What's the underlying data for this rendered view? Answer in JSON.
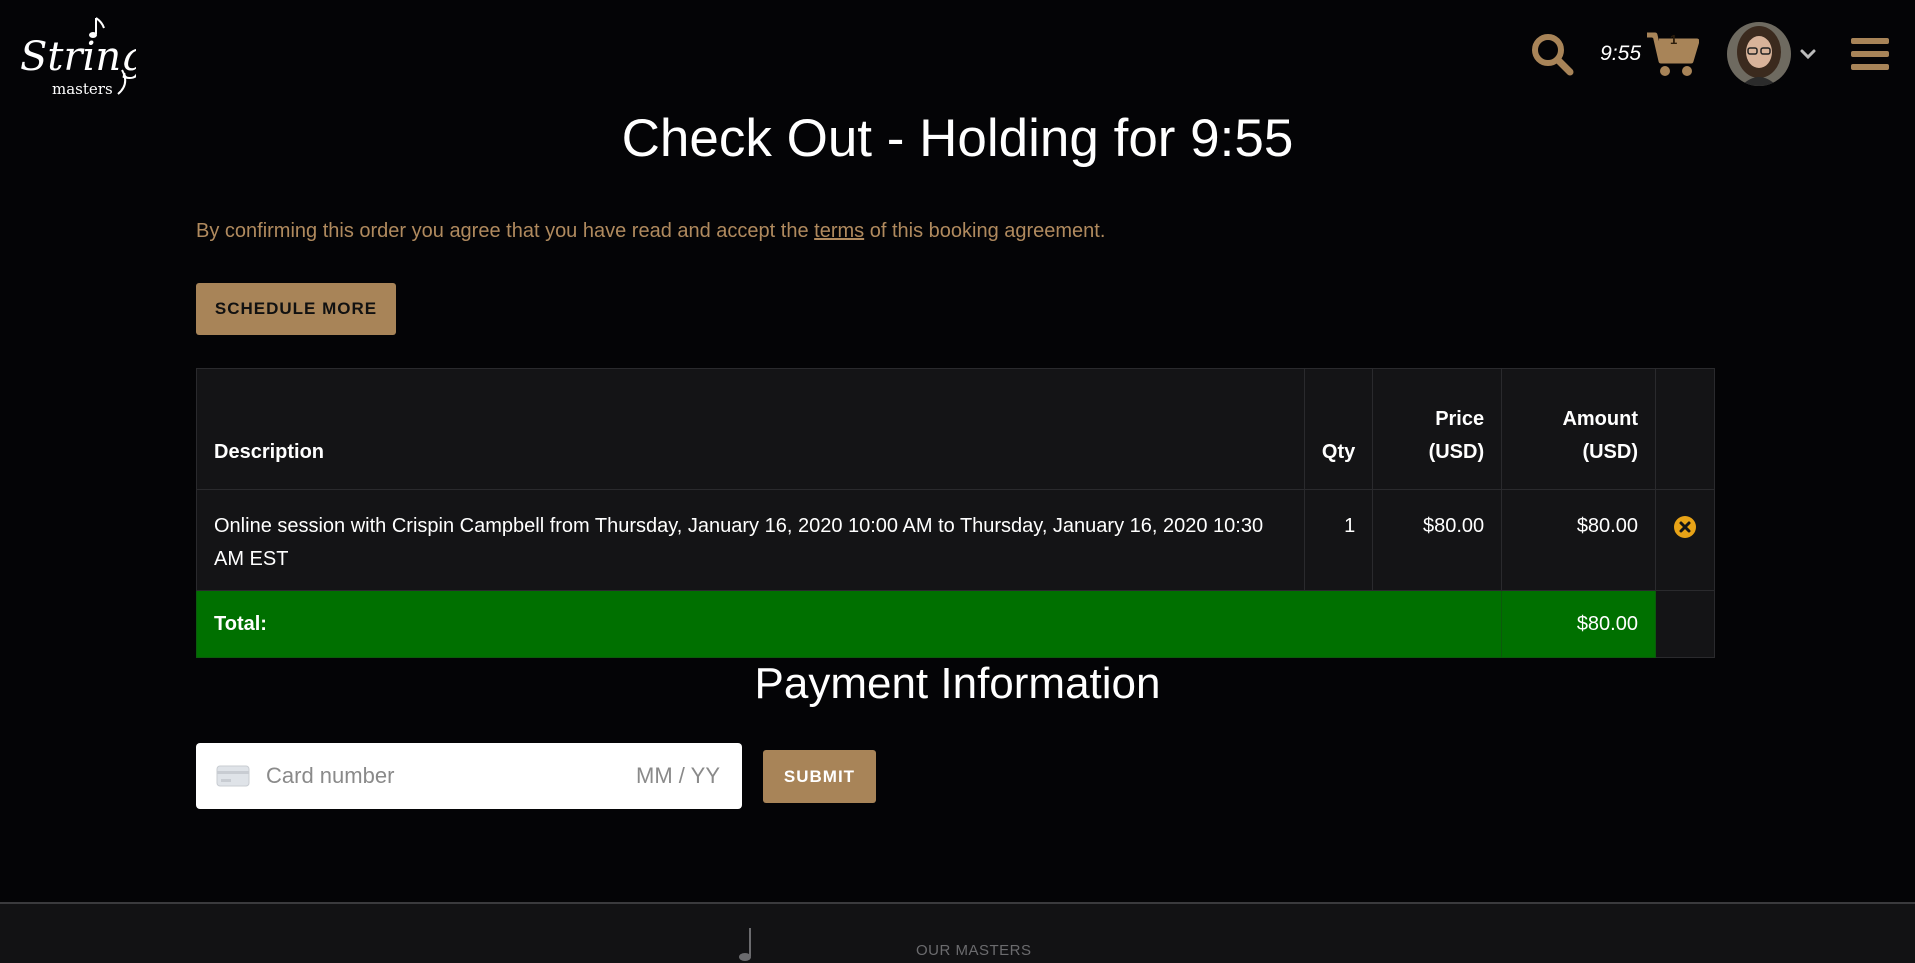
{
  "header": {
    "logo_text": "String masters",
    "timer": "9:55",
    "cart_count": "1"
  },
  "page": {
    "title": "Check Out - Holding for 9:55",
    "agreement_before": "By confirming this order you agree that you have read and accept the ",
    "agreement_link": "terms",
    "agreement_after": " of this booking agreement.",
    "schedule_more_label": "SCHEDULE MORE"
  },
  "table": {
    "headers": {
      "description": "Description",
      "qty": "Qty",
      "price_line1": "Price",
      "price_line2": "(USD)",
      "amount_line1": "Amount",
      "amount_line2": "(USD)"
    },
    "rows": [
      {
        "description": "Online session with Crispin Campbell from Thursday, January 16, 2020 10:00 AM to Thursday, January 16, 2020 10:30 AM EST",
        "qty": "1",
        "price": "$80.00",
        "amount": "$80.00"
      }
    ],
    "total_label": "Total:",
    "total_amount": "$80.00"
  },
  "payment": {
    "title": "Payment Information",
    "card_placeholder": "Card number",
    "exp_placeholder": "MM / YY",
    "submit_label": "SUBMIT"
  },
  "footer": {
    "link": "OUR MASTERS"
  },
  "colors": {
    "accent": "#a88458",
    "background": "#040406",
    "total_green": "#007000",
    "remove_icon": "#e8a317"
  },
  "icons": {
    "search": "search-icon",
    "cart": "cart-icon",
    "menu": "hamburger-menu-icon",
    "remove": "remove-icon",
    "card": "credit-card-icon"
  }
}
